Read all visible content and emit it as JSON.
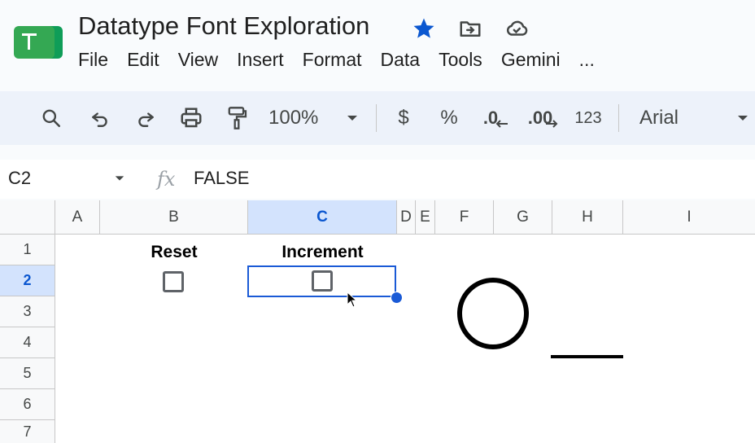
{
  "header": {
    "title": "Datatype Font Exploration",
    "menu": [
      "File",
      "Edit",
      "View",
      "Insert",
      "Format",
      "Data",
      "Tools",
      "Gemini",
      "..."
    ]
  },
  "icons": {
    "logo": "sheets-logo-icon",
    "star": "star-icon",
    "move": "move-to-folder-icon",
    "cloud": "cloud-saved-icon"
  },
  "toolbar": {
    "zoom": "100%",
    "currency": "$",
    "percent": "%",
    "decrease_decimal": ".0",
    "increase_decimal": ".00",
    "number_format": "123",
    "font": "Arial"
  },
  "formula_bar": {
    "cell_ref": "C2",
    "fx": "fx",
    "value": "FALSE"
  },
  "grid": {
    "columns": [
      "A",
      "B",
      "C",
      "D",
      "E",
      "F",
      "G",
      "H",
      "I"
    ],
    "rows": [
      "1",
      "2",
      "3",
      "4",
      "5",
      "6",
      "7"
    ],
    "selected_column": "C",
    "selected_row": "2",
    "cells": {
      "B1": "Reset",
      "C1": "Increment",
      "B2": false,
      "C2": false
    }
  },
  "colors": {
    "accent": "#0b57d0",
    "selection": "#1a5ad6",
    "header_selected": "#d3e3fd",
    "star": "#0b57d0",
    "logo": "#188038"
  }
}
